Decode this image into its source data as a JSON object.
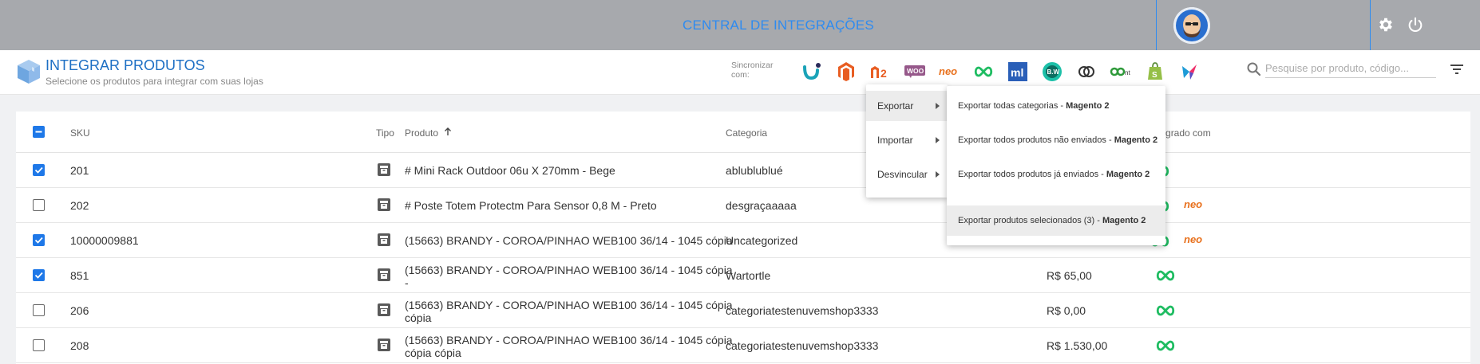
{
  "topbar": {
    "title": "CENTRAL DE INTEGRAÇÕES",
    "settings_icon": "gear-icon",
    "logout_icon": "power-icon"
  },
  "header": {
    "title": "INTEGRAR PRODUTOS",
    "subtitle": "Selecione os produtos para integrar com suas lojas",
    "sync_label_line1": "Sincronizar",
    "sync_label_line2": "com:",
    "integrations": [
      {
        "name": "Uappi",
        "color": "#1aa3b8"
      },
      {
        "name": "Magento",
        "color": "#e85d22"
      },
      {
        "name": "Magento 2",
        "color": "#e85d22",
        "text": "M2"
      },
      {
        "name": "WooCommerce",
        "color": "#96588a",
        "text": "woo"
      },
      {
        "name": "Neo",
        "color": "#e8701c",
        "text": "neo"
      },
      {
        "name": "Nuvemshop",
        "color": "#1ebc61"
      },
      {
        "name": "Mercado Livre",
        "color": "#2a5fb8",
        "text": "ml"
      },
      {
        "name": "B2W",
        "color": "#1cc0a8",
        "text": "B.W"
      },
      {
        "name": "Link",
        "color": "#333333"
      },
      {
        "name": "Connect",
        "color": "#2e9a3a",
        "text": "co"
      },
      {
        "name": "Shopify",
        "color": "#95bf47"
      },
      {
        "name": "Tray",
        "color": "#ee2e6a"
      }
    ],
    "search_placeholder": "Pesquise por produto, código..."
  },
  "table": {
    "columns": {
      "sku": "SKU",
      "tipo": "Tipo",
      "produto": "Produto",
      "categoria": "Categoria",
      "integrado": "Integrado com"
    },
    "rows": [
      {
        "checked": true,
        "sku": "201",
        "produto": "# Mini Rack Outdoor 06u X 270mm - Bege",
        "produto_2": "",
        "categoria": "ablublublué",
        "preco": "",
        "integrations": [
          "nuvemshop"
        ]
      },
      {
        "checked": false,
        "sku": "202",
        "produto": "# Poste Totem Protectm Para Sensor 0,8 M - Preto",
        "produto_2": "",
        "categoria": "desgraçaaaaa",
        "preco": "",
        "integrations": [
          "nuvemshop",
          "neo"
        ]
      },
      {
        "checked": true,
        "sku": "10000009881",
        "produto": "(15663) BRANDY - COROA/PINHAO WEB100 36/14 - 1045 cópia",
        "produto_2": "",
        "categoria": "Uncategorized",
        "preco": "",
        "integrations": [
          "nuvemshop",
          "neo"
        ]
      },
      {
        "checked": true,
        "sku": "851",
        "produto": "(15663) BRANDY - COROA/PINHAO WEB100 36/14 - 1045 cópia",
        "produto_2": "-",
        "categoria": "Wartortle",
        "preco": "R$ 65,00",
        "integrations": [
          "nuvemshop"
        ]
      },
      {
        "checked": false,
        "sku": "206",
        "produto": "(15663) BRANDY - COROA/PINHAO WEB100 36/14 - 1045 cópia",
        "produto_2": "cópia",
        "categoria": "categoriatestenuvemshop3333",
        "preco": "R$ 0,00",
        "integrations": [
          "nuvemshop"
        ]
      },
      {
        "checked": false,
        "sku": "208",
        "produto": "(15663) BRANDY - COROA/PINHAO WEB100 36/14 - 1045 cópia",
        "produto_2": "cópia cópia",
        "categoria": "categoriatestenuvemshop3333",
        "preco": "R$ 1.530,00",
        "integrations": [
          "nuvemshop"
        ]
      }
    ]
  },
  "menu": {
    "items": [
      {
        "label": "Exportar",
        "active": true
      },
      {
        "label": "Importar",
        "active": false
      },
      {
        "label": "Desvincular",
        "active": false
      }
    ],
    "submenu": [
      {
        "text": "Exportar todas categorias - ",
        "bold": "Magento 2",
        "active": false
      },
      {
        "text": "Exportar todos produtos não enviados - ",
        "bold": "Magento 2",
        "active": false
      },
      {
        "text": "Exportar todos produtos já enviados - ",
        "bold": "Magento 2",
        "active": false
      },
      {
        "text": "Exportar produtos selecionados (3) - ",
        "bold": "Magento 2",
        "active": true
      }
    ]
  },
  "colors": {
    "accent": "#1e78e8",
    "topbar": "#a7a9ad",
    "nuvemshop": "#1ebc61",
    "neo": "#e8701c"
  }
}
